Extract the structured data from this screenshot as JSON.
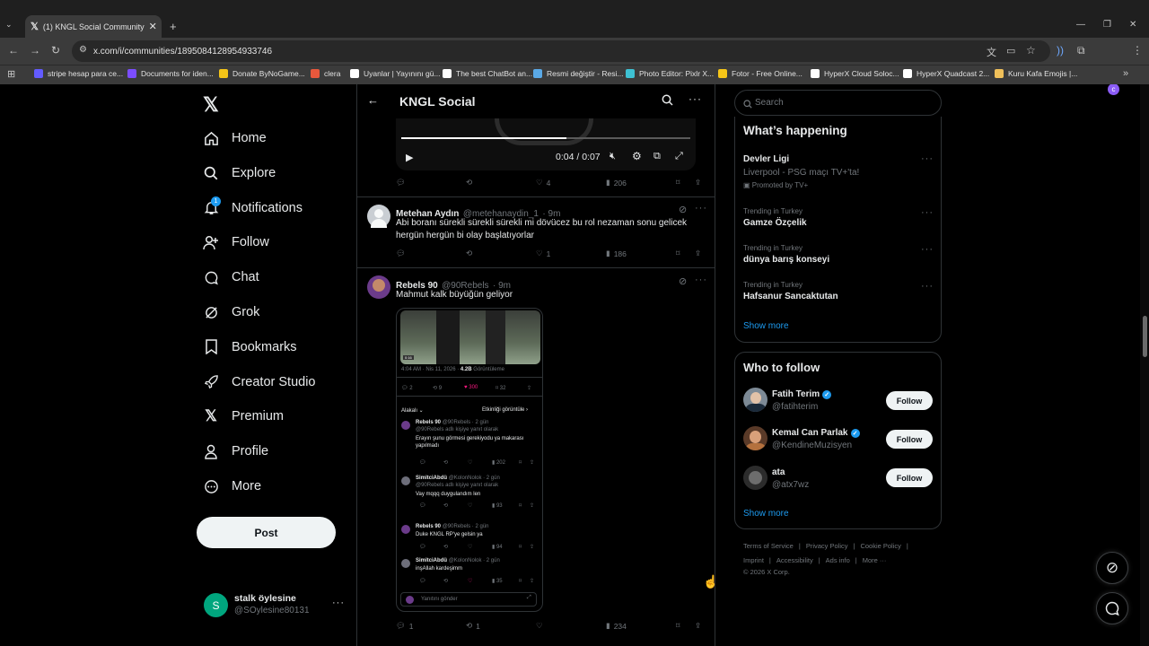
{
  "browser": {
    "tab_title": "(1) KNGL Social Community",
    "url": "x.com/i/communities/1895084128954933746",
    "bookmarks": [
      {
        "label": "stripe hesap para ce...",
        "color": "#635bff"
      },
      {
        "label": "Documents for iden...",
        "color": "#7c4dff"
      },
      {
        "label": "Donate ByNoGame...",
        "color": "#f5c518"
      },
      {
        "label": "clera",
        "color": "#e8583c"
      },
      {
        "label": "Uyanlar | Yayınını gü...",
        "color": "#ffffff"
      },
      {
        "label": "The best ChatBot an...",
        "color": "#ffffff"
      },
      {
        "label": "Resmi değiştir - Resi...",
        "color": "#5aa9e6"
      },
      {
        "label": "Photo Editor: Pixlr X...",
        "color": "#3ec1d3"
      },
      {
        "label": "Fotor - Free Online...",
        "color": "#f5c518"
      },
      {
        "label": "HyperX Cloud Soloc...",
        "color": "#ffffff"
      },
      {
        "label": "HyperX Quadcast 2...",
        "color": "#ffffff"
      },
      {
        "label": "Kuru Kafa Emojis |...",
        "color": "#f0c05a"
      }
    ]
  },
  "nav": {
    "items": [
      {
        "label": "Home",
        "icon": "home-icon"
      },
      {
        "label": "Explore",
        "icon": "search-icon"
      },
      {
        "label": "Notifications",
        "icon": "bell-icon",
        "badge": "1"
      },
      {
        "label": "Follow",
        "icon": "follow-icon"
      },
      {
        "label": "Chat",
        "icon": "chat-icon"
      },
      {
        "label": "Grok",
        "icon": "grok-icon"
      },
      {
        "label": "Bookmarks",
        "icon": "bookmark-icon"
      },
      {
        "label": "Creator Studio",
        "icon": "rocket-icon"
      },
      {
        "label": "Premium",
        "icon": "x-logo-icon"
      },
      {
        "label": "Profile",
        "icon": "person-icon"
      },
      {
        "label": "More",
        "icon": "more-circle-icon"
      }
    ],
    "post_label": "Post",
    "account": {
      "name": "stalk öylesine",
      "handle": "@SOylesine80131",
      "avatar_letter": "S",
      "avatar_color": "#00a67e"
    }
  },
  "header": {
    "title": "KNGL Social"
  },
  "video": {
    "time": "0:04 / 0:07",
    "progress": 0.57
  },
  "tweets": [
    {
      "actions": {
        "reply": "",
        "retweet": "",
        "like": "4",
        "views": "206"
      }
    },
    {
      "name": "Metehan Aydın",
      "handle": "@metehanaydin_1",
      "time": "· 9m",
      "text": "Abi boranı sürekli sürekli sürekli mi dövücez bu rol nezaman sonu gelicek hergün hergün bi olay başlatıyorlar",
      "actions": {
        "reply": "",
        "retweet": "",
        "like": "1",
        "views": "186"
      }
    },
    {
      "name": "Rebels 90",
      "handle": "@90Rebels",
      "time": "· 9m",
      "text": "Mahmut kalk büyüğün geliyor",
      "actions": {
        "reply": "1",
        "retweet": "1",
        "like": "",
        "views": "234"
      }
    }
  ],
  "embedded": {
    "meta_time": "4:04 AM · Nis 11, 2026 · ",
    "meta_views": "4.2B",
    "meta_views_label": " Görüntüleme",
    "stats": {
      "reply": "2",
      "retweet": "9",
      "like": "300",
      "bookmark": "32"
    },
    "sort_label": "Alakalı",
    "activity_label": "Etkinliği görüntüle",
    "replies": [
      {
        "name": "Rebels 90",
        "handle": "@90Rebels · 2 gün",
        "to": "@90Rebels adlı kişiye yanıt olarak",
        "text": "Erayın şunu görmesi gerekiyodu ya makarası yapılmadı",
        "views": "202"
      },
      {
        "name": "SimitciAbdü",
        "handle": "@KolonNolok · 2 gün",
        "to": "@90Rebels adlı kişiye yanıt olarak",
        "text": "Vay mqqq duygulandım len",
        "views": "93"
      },
      {
        "name": "Rebels 90",
        "handle": "@90Rebels · 2 gün",
        "to": "",
        "text": "Duke KNGL RP'ye gelsin ya",
        "views": "94"
      },
      {
        "name": "SimitciAbdü",
        "handle": "@KolonNolok · 2 gün",
        "to": "",
        "text": "inşAllah kardeşimm",
        "views": "35"
      }
    ],
    "reply_placeholder": "Yanıtını gönder"
  },
  "search": {
    "placeholder": "Search"
  },
  "trends": {
    "title": "What’s happening",
    "items": [
      {
        "name": "Devler Ligi",
        "sub": "Liverpool - PSG maçı TV+'ta!",
        "promo": "Promoted by TV+"
      },
      {
        "context": "Trending in Turkey",
        "name": "Gamze Özçelik"
      },
      {
        "context": "Trending in Turkey",
        "name": "dünya barış konseyi"
      },
      {
        "context": "Trending in Turkey",
        "name": "Hafsanur Sancaktutan"
      }
    ],
    "show_more": "Show more"
  },
  "who_to_follow": {
    "title": "Who to follow",
    "items": [
      {
        "name": "Fatih Terim",
        "handle": "@fatihterim",
        "verified": true
      },
      {
        "name": "Kemal Can Parlak",
        "handle": "@KendineMuzisyen",
        "verified": true
      },
      {
        "name": "ata",
        "handle": "@atx7wz",
        "verified": false
      }
    ],
    "follow_label": "Follow",
    "show_more": "Show more"
  },
  "footer": {
    "links": [
      "Terms of Service",
      "Privacy Policy",
      "Cookie Policy",
      "Imprint",
      "Accessibility",
      "Ads info",
      "More ···"
    ],
    "copyright": "© 2026 X Corp."
  },
  "colors": {
    "accent": "#1d9bf0",
    "like_pink": "#f91880",
    "bg": "#000000"
  }
}
